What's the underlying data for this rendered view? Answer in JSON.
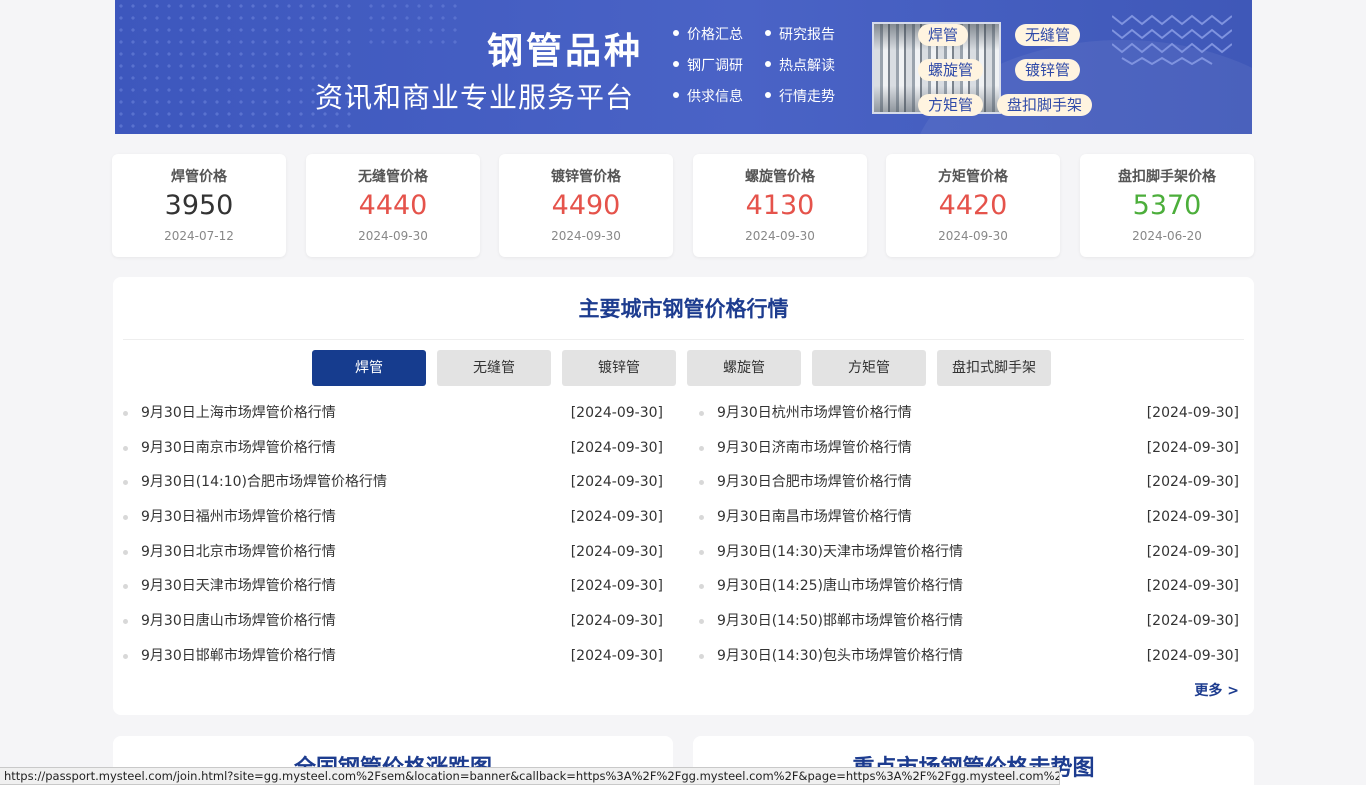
{
  "banner": {
    "title": "钢管品种",
    "subtitle": "资讯和商业专业服务平台",
    "links": [
      "价格汇总",
      "研究报告",
      "钢厂调研",
      "热点解读",
      "供求信息",
      "行情走势"
    ],
    "pills": [
      "焊管",
      "无缝管",
      "螺旋管",
      "镀锌管",
      "方矩管",
      "盘扣脚手架"
    ]
  },
  "prices": [
    {
      "title": "焊管价格",
      "value": "3950",
      "date": "2024-07-12",
      "color": "#333333"
    },
    {
      "title": "无缝管价格",
      "value": "4440",
      "date": "2024-09-30",
      "color": "#e5534b"
    },
    {
      "title": "镀锌管价格",
      "value": "4490",
      "date": "2024-09-30",
      "color": "#e5534b"
    },
    {
      "title": "螺旋管价格",
      "value": "4130",
      "date": "2024-09-30",
      "color": "#e5534b"
    },
    {
      "title": "方矩管价格",
      "value": "4420",
      "date": "2024-09-30",
      "color": "#e5534b"
    },
    {
      "title": "盘扣脚手架价格",
      "value": "5370",
      "date": "2024-06-20",
      "color": "#4cae3b"
    }
  ],
  "main": {
    "title": "主要城市钢管价格行情",
    "tabs": [
      "焊管",
      "无缝管",
      "镀锌管",
      "螺旋管",
      "方矩管",
      "盘扣式脚手架"
    ],
    "active_tab": 0,
    "left_list": [
      {
        "title": "9月30日上海市场焊管价格行情",
        "date": "[2024-09-30]"
      },
      {
        "title": "9月30日南京市场焊管价格行情",
        "date": "[2024-09-30]"
      },
      {
        "title": "9月30日(14:10)合肥市场焊管价格行情",
        "date": "[2024-09-30]"
      },
      {
        "title": "9月30日福州市场焊管价格行情",
        "date": "[2024-09-30]"
      },
      {
        "title": "9月30日北京市场焊管价格行情",
        "date": "[2024-09-30]"
      },
      {
        "title": "9月30日天津市场焊管价格行情",
        "date": "[2024-09-30]"
      },
      {
        "title": "9月30日唐山市场焊管价格行情",
        "date": "[2024-09-30]"
      },
      {
        "title": "9月30日邯郸市场焊管价格行情",
        "date": "[2024-09-30]"
      }
    ],
    "right_list": [
      {
        "title": "9月30日杭州市场焊管价格行情",
        "date": "[2024-09-30]"
      },
      {
        "title": "9月30日济南市场焊管价格行情",
        "date": "[2024-09-30]"
      },
      {
        "title": "9月30日合肥市场焊管价格行情",
        "date": "[2024-09-30]"
      },
      {
        "title": "9月30日南昌市场焊管价格行情",
        "date": "[2024-09-30]"
      },
      {
        "title": "9月30日(14:30)天津市场焊管价格行情",
        "date": "[2024-09-30]"
      },
      {
        "title": "9月30日(14:25)唐山市场焊管价格行情",
        "date": "[2024-09-30]"
      },
      {
        "title": "9月30日(14:50)邯郸市场焊管价格行情",
        "date": "[2024-09-30]"
      },
      {
        "title": "9月30日(14:30)包头市场焊管价格行情",
        "date": "[2024-09-30]"
      }
    ],
    "more": "更多 >"
  },
  "bottom": {
    "left_title": "全国钢管价格涨跌图",
    "right_title": "重点市场钢管价格走势图"
  },
  "status_url": "https://passport.mysteel.com/join.html?site=gg.mysteel.com%2Fsem&location=banner&callback=https%3A%2F%2Fgg.mysteel.com%2F&page=https%3A%2F%2Fgg.mysteel.com%2Fsem%2F5"
}
